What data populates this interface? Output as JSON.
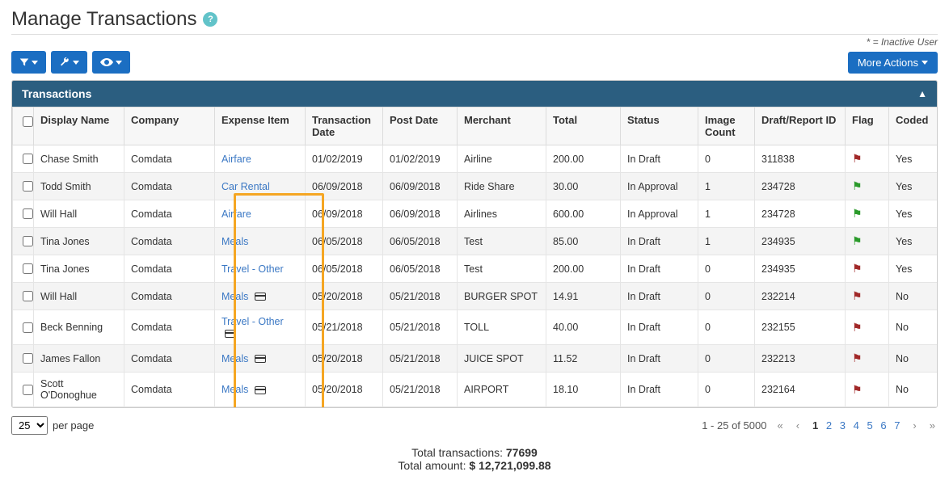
{
  "header": {
    "title": "Manage Transactions",
    "help_tooltip": "?"
  },
  "note": "* = Inactive User",
  "toolbar": {
    "filter_tooltip": "Filter",
    "tools_tooltip": "Tools",
    "view_tooltip": "View",
    "more_actions": "More Actions"
  },
  "panel": {
    "title": "Transactions"
  },
  "columns": {
    "display_name": "Display Name",
    "company": "Company",
    "expense_item": "Expense Item",
    "txn_date": "Transaction Date",
    "post_date": "Post Date",
    "merchant": "Merchant",
    "total": "Total",
    "status": "Status",
    "image_count": "Image Count",
    "draft_id": "Draft/Report ID",
    "flag": "Flag",
    "coded": "Coded"
  },
  "rows": [
    {
      "name": "Chase Smith",
      "company": "Comdata",
      "expense": "Airfare",
      "card": false,
      "txn_date": "01/02/2019",
      "post_date": "01/02/2019",
      "merchant": "Airline",
      "total": "200.00",
      "status": "In Draft",
      "img": "0",
      "draft": "311838",
      "flag": "red",
      "coded": "Yes"
    },
    {
      "name": "Todd Smith",
      "company": "Comdata",
      "expense": "Car Rental",
      "card": false,
      "txn_date": "06/09/2018",
      "post_date": "06/09/2018",
      "merchant": "Ride Share",
      "total": "30.00",
      "status": "In Approval",
      "img": "1",
      "draft": "234728",
      "flag": "green",
      "coded": "Yes"
    },
    {
      "name": "Will Hall",
      "company": "Comdata",
      "expense": "Airfare",
      "card": false,
      "txn_date": "06/09/2018",
      "post_date": "06/09/2018",
      "merchant": "Airlines",
      "total": "600.00",
      "status": "In Approval",
      "img": "1",
      "draft": "234728",
      "flag": "green",
      "coded": "Yes"
    },
    {
      "name": "Tina Jones",
      "company": "Comdata",
      "expense": "Meals",
      "card": false,
      "txn_date": "06/05/2018",
      "post_date": "06/05/2018",
      "merchant": "Test",
      "total": "85.00",
      "status": "In Draft",
      "img": "1",
      "draft": "234935",
      "flag": "green",
      "coded": "Yes"
    },
    {
      "name": "Tina Jones",
      "company": "Comdata",
      "expense": "Travel - Other",
      "card": false,
      "txn_date": "06/05/2018",
      "post_date": "06/05/2018",
      "merchant": "Test",
      "total": "200.00",
      "status": "In Draft",
      "img": "0",
      "draft": "234935",
      "flag": "red",
      "coded": "Yes"
    },
    {
      "name": "Will Hall",
      "company": "Comdata",
      "expense": "Meals",
      "card": true,
      "txn_date": "05/20/2018",
      "post_date": "05/21/2018",
      "merchant": "BURGER SPOT",
      "total": "14.91",
      "status": "In Draft",
      "img": "0",
      "draft": "232214",
      "flag": "red",
      "coded": "No"
    },
    {
      "name": "Beck Benning",
      "company": "Comdata",
      "expense": "Travel - Other",
      "card": true,
      "txn_date": "05/21/2018",
      "post_date": "05/21/2018",
      "merchant": "TOLL",
      "total": "40.00",
      "status": "In Draft",
      "img": "0",
      "draft": "232155",
      "flag": "red",
      "coded": "No"
    },
    {
      "name": "James Fallon",
      "company": "Comdata",
      "expense": "Meals",
      "card": true,
      "txn_date": "05/20/2018",
      "post_date": "05/21/2018",
      "merchant": "JUICE SPOT",
      "total": "11.52",
      "status": "In Draft",
      "img": "0",
      "draft": "232213",
      "flag": "red",
      "coded": "No"
    },
    {
      "name": "Scott O'Donoghue",
      "company": "Comdata",
      "expense": "Meals",
      "card": true,
      "txn_date": "05/20/2018",
      "post_date": "05/21/2018",
      "merchant": "AIRPORT",
      "total": "18.10",
      "status": "In Draft",
      "img": "0",
      "draft": "232164",
      "flag": "red",
      "coded": "No"
    }
  ],
  "pagination": {
    "page_size": "25",
    "per_page_label": "per page",
    "range": "1 - 25 of 5000",
    "pages": [
      "1",
      "2",
      "3",
      "4",
      "5",
      "6",
      "7"
    ],
    "active_page": "1"
  },
  "totals": {
    "txn_label": "Total transactions:",
    "txn_value": "77699",
    "amt_label": "Total amount:",
    "amt_value": "$ 12,721,099.88"
  }
}
